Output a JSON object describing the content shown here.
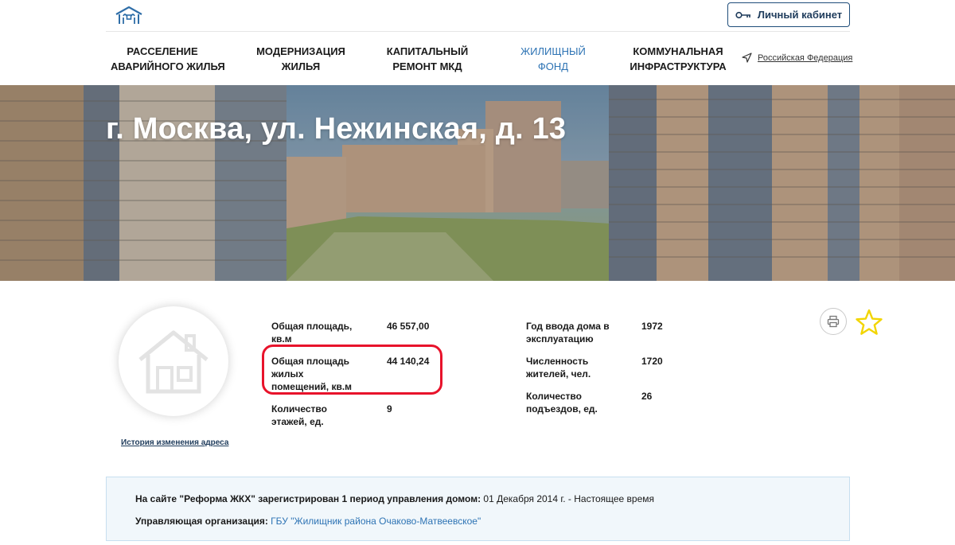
{
  "header": {
    "cabinet_label": "Личный кабинет",
    "region_label": "Российская Федерация",
    "nav": [
      {
        "line1": "РАССЕЛЕНИЕ",
        "line2": "АВАРИЙНОГО ЖИЛЬЯ",
        "active": false
      },
      {
        "line1": "МОДЕРНИЗАЦИЯ",
        "line2": "ЖИЛЬЯ",
        "active": false
      },
      {
        "line1": "КАПИТАЛЬНЫЙ",
        "line2": "РЕМОНТ МКД",
        "active": false
      },
      {
        "line1": "ЖИЛИЩНЫЙ",
        "line2": "ФОНД",
        "active": true
      },
      {
        "line1": "КОММУНАЛЬНАЯ",
        "line2": "ИНФРАСТРУКТУРА",
        "active": false
      }
    ],
    "accent_color": "#2d73b4",
    "icons": {
      "logo": "house-logo-icon",
      "key": "key-icon",
      "region": "location-arrow-icon"
    }
  },
  "hero": {
    "title": "г. Москва, ул. Нежинская, д. 13"
  },
  "building": {
    "history_link": "История изменения адреса",
    "left_props": [
      {
        "label": "Общая площадь, кв.м",
        "value": "46 557,00"
      },
      {
        "label": "Общая площадь жилых помещений, кв.м",
        "value": "44 140,24"
      },
      {
        "label": "Количество этажей, ед.",
        "value": "9"
      }
    ],
    "right_props": [
      {
        "label": "Год ввода дома в эксплуатацию",
        "value": "1972"
      },
      {
        "label": "Численность жителей, чел.",
        "value": "1720"
      },
      {
        "label": "Количество подъездов, ед.",
        "value": "26"
      }
    ],
    "highlight_color": "#e8132b",
    "icons": {
      "avatar": "house-outline-icon",
      "print": "printer-icon",
      "favorite": "star-icon"
    }
  },
  "info_box": {
    "period_prefix": "На сайте \"Реформа ЖКХ\" зарегистрирован 1 период управления домом:",
    "period_value": " 01 Декабря 2014 г. - Настоящее время",
    "org_prefix": "Управляющая организация:",
    "org_link": "ГБУ \"Жилищник района Очаково-Матвеевское\""
  }
}
